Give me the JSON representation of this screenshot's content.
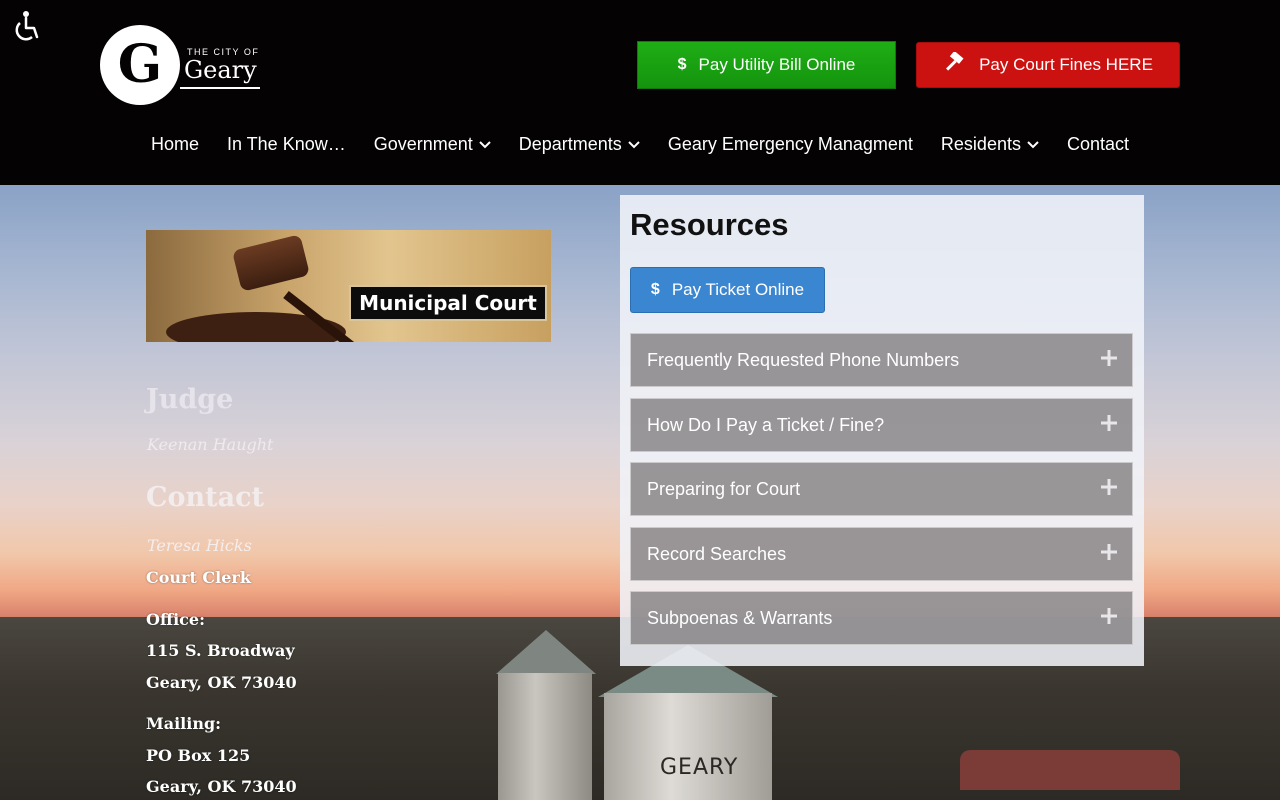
{
  "header": {
    "logo": {
      "small_text": "THE CITY OF",
      "name": "Geary",
      "glyph": "G"
    },
    "utility_button": {
      "label": "Pay Utility Bill Online",
      "icon": "dollar-icon"
    },
    "court_button": {
      "label": "Pay Court Fines HERE",
      "icon": "gavel-icon"
    },
    "nav": [
      {
        "label": "Home",
        "dropdown": false
      },
      {
        "label": "In The Know…",
        "dropdown": false
      },
      {
        "label": "Government",
        "dropdown": true
      },
      {
        "label": "Departments",
        "dropdown": true
      },
      {
        "label": "Geary Emergency Managment",
        "dropdown": false
      },
      {
        "label": "Residents",
        "dropdown": true
      },
      {
        "label": "Contact",
        "dropdown": false
      }
    ]
  },
  "banner": {
    "label": "Municipal Court"
  },
  "judge": {
    "heading": "Judge",
    "name": "Keenan Haught"
  },
  "contact": {
    "heading": "Contact",
    "name": "Teresa Hicks",
    "title": "Court Clerk",
    "office_label": "Office:",
    "office_line1": "115 S. Broadway",
    "office_line2": "Geary, OK 73040",
    "mailing_label": "Mailing:",
    "mailing_line1": "PO Box 125",
    "mailing_line2": "Geary, OK 73040"
  },
  "resources": {
    "title": "Resources",
    "ticket_button": "Pay Ticket Online",
    "accordion": [
      "Frequently Requested Phone Numbers",
      "How Do I Pay a Ticket / Fine?",
      "Preparing for Court",
      "Record Searches",
      "Subpoenas & Warrants"
    ]
  },
  "scene": {
    "tower_text": "GEARY"
  },
  "colors": {
    "utility_green": "#14940e",
    "court_red": "#cc1111",
    "ticket_blue": "#3b86d0",
    "header_bg": "#040203"
  }
}
